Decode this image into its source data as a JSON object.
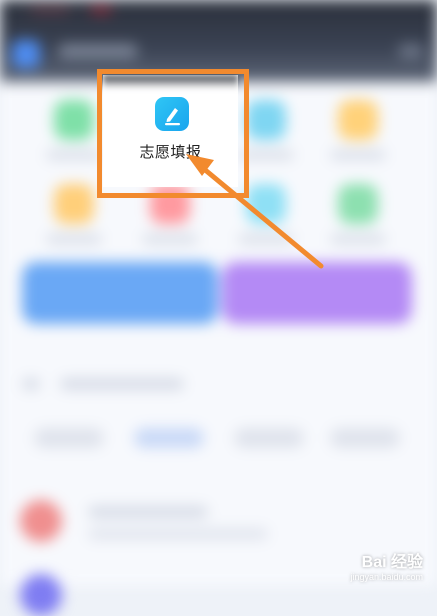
{
  "highlighted_app": {
    "label": "志愿填报",
    "icon": "pencil-edit-icon",
    "icon_color": "#1fb3f2"
  },
  "annotation": {
    "frame_color": "#f28a2e",
    "arrow_color": "#f28a2e"
  },
  "blurred_background": {
    "app_icon_colors": [
      "#7fe0a8",
      "#7fd6f2",
      "#ffd27a",
      "#ffcf7a",
      "#ff9aa0",
      "#8fe0f5",
      "#8de0b0"
    ],
    "banner_colors": [
      "#6aa8f5",
      "#b48af5"
    ],
    "list_avatar_colors": [
      "#f08f8f",
      "#7f7df2"
    ]
  },
  "watermark": {
    "logo": "Bai 经验",
    "url": "jingyan.baidu.com"
  }
}
